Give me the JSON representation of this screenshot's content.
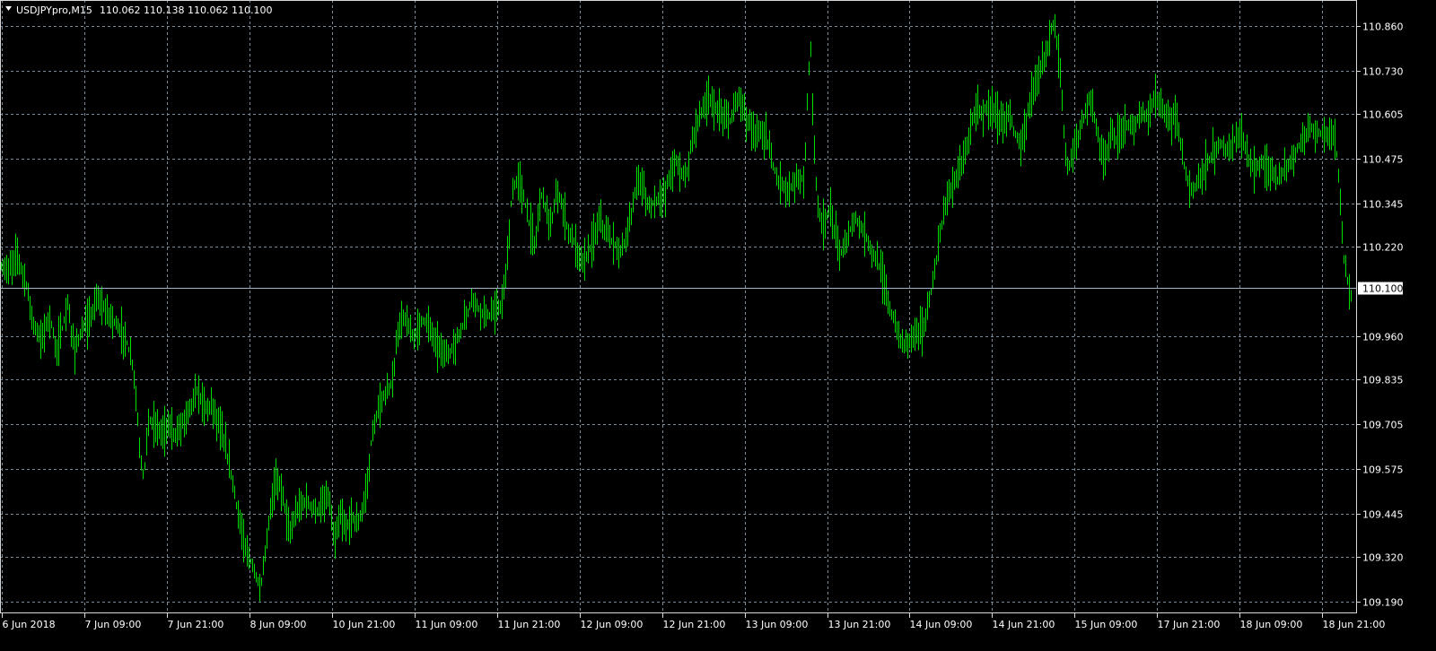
{
  "header": {
    "symbol_label": "USDJPYpro,M15",
    "ohlc": "110.062 110.138 110.062 110.100"
  },
  "colors": {
    "background": "#000000",
    "bars": "#00dd00",
    "grid": "#778899",
    "text": "#ffffff",
    "price_line": "#a0b4c8"
  },
  "icons": {
    "dropdown": "triangle-down-icon"
  },
  "chart_data": {
    "type": "line",
    "style": "ohlc-bars",
    "grid": true,
    "ylim": [
      109.155,
      110.935
    ],
    "y_ticks": [
      "110.860",
      "110.730",
      "110.605",
      "110.475",
      "110.345",
      "110.220",
      "110.100",
      "109.960",
      "109.835",
      "109.705",
      "109.575",
      "109.445",
      "109.320",
      "109.190"
    ],
    "x_ticks": [
      "6 Jun 2018",
      "7 Jun 09:00",
      "7 Jun 21:00",
      "8 Jun 09:00",
      "10 Jun 21:00",
      "11 Jun 09:00",
      "11 Jun 21:00",
      "12 Jun 09:00",
      "12 Jun 21:00",
      "13 Jun 09:00",
      "13 Jun 21:00",
      "14 Jun 09:00",
      "14 Jun 21:00",
      "15 Jun 09:00",
      "17 Jun 21:00",
      "18 Jun 09:00",
      "18 Jun 21:00"
    ],
    "current_price": 110.1,
    "series": [
      {
        "keypoints": [
          [
            0,
            110.16
          ],
          [
            10,
            110.15
          ],
          [
            18,
            110.2
          ],
          [
            30,
            110.1
          ],
          [
            36,
            110.0
          ],
          [
            45,
            109.95
          ],
          [
            55,
            110.02
          ],
          [
            62,
            109.92
          ],
          [
            68,
            109.97
          ],
          [
            75,
            110.05
          ],
          [
            82,
            109.92
          ],
          [
            90,
            109.97
          ],
          [
            100,
            110.01
          ],
          [
            108,
            110.07
          ],
          [
            115,
            110.04
          ],
          [
            122,
            110.02
          ],
          [
            130,
            109.99
          ],
          [
            140,
            109.95
          ],
          [
            148,
            109.87
          ],
          [
            152,
            109.75
          ],
          [
            156,
            109.6
          ],
          [
            160,
            109.55
          ],
          [
            165,
            109.72
          ],
          [
            172,
            109.7
          ],
          [
            180,
            109.68
          ],
          [
            188,
            109.7
          ],
          [
            195,
            109.67
          ],
          [
            205,
            109.72
          ],
          [
            212,
            109.76
          ],
          [
            220,
            109.8
          ],
          [
            228,
            109.75
          ],
          [
            236,
            109.76
          ],
          [
            244,
            109.7
          ],
          [
            252,
            109.62
          ],
          [
            258,
            109.55
          ],
          [
            265,
            109.44
          ],
          [
            272,
            109.35
          ],
          [
            280,
            109.3
          ],
          [
            290,
            109.22
          ],
          [
            296,
            109.35
          ],
          [
            302,
            109.48
          ],
          [
            308,
            109.55
          ],
          [
            315,
            109.5
          ],
          [
            322,
            109.38
          ],
          [
            330,
            109.45
          ],
          [
            338,
            109.48
          ],
          [
            345,
            109.47
          ],
          [
            352,
            109.45
          ],
          [
            360,
            109.47
          ],
          [
            366,
            109.5
          ],
          [
            372,
            109.35
          ],
          [
            378,
            109.44
          ],
          [
            385,
            109.4
          ],
          [
            392,
            109.44
          ],
          [
            398,
            109.41
          ],
          [
            404,
            109.46
          ],
          [
            410,
            109.55
          ],
          [
            414,
            109.68
          ],
          [
            420,
            109.73
          ],
          [
            426,
            109.78
          ],
          [
            432,
            109.8
          ],
          [
            438,
            109.84
          ],
          [
            442,
            109.96
          ],
          [
            448,
            110.02
          ],
          [
            455,
            109.98
          ],
          [
            462,
            109.96
          ],
          [
            470,
            110.01
          ],
          [
            478,
            109.99
          ],
          [
            485,
            109.94
          ],
          [
            492,
            109.92
          ],
          [
            498,
            109.9
          ],
          [
            505,
            109.93
          ],
          [
            512,
            109.97
          ],
          [
            520,
            110.02
          ],
          [
            525,
            110.07
          ],
          [
            530,
            110.05
          ],
          [
            537,
            110.03
          ],
          [
            545,
            110.02
          ],
          [
            552,
            110.03
          ],
          [
            558,
            110.05
          ],
          [
            562,
            110.1
          ],
          [
            566,
            110.22
          ],
          [
            570,
            110.38
          ],
          [
            574,
            110.4
          ],
          [
            578,
            110.42
          ],
          [
            584,
            110.35
          ],
          [
            590,
            110.28
          ],
          [
            596,
            110.22
          ],
          [
            602,
            110.38
          ],
          [
            608,
            110.33
          ],
          [
            614,
            110.28
          ],
          [
            620,
            110.38
          ],
          [
            626,
            110.34
          ],
          [
            632,
            110.27
          ],
          [
            638,
            110.24
          ],
          [
            644,
            110.2
          ],
          [
            650,
            110.17
          ],
          [
            656,
            110.21
          ],
          [
            662,
            110.25
          ],
          [
            668,
            110.3
          ],
          [
            674,
            110.26
          ],
          [
            680,
            110.24
          ],
          [
            686,
            110.22
          ],
          [
            692,
            110.21
          ],
          [
            698,
            110.24
          ],
          [
            704,
            110.33
          ],
          [
            710,
            110.42
          ],
          [
            716,
            110.39
          ],
          [
            722,
            110.33
          ],
          [
            728,
            110.35
          ],
          [
            734,
            110.36
          ],
          [
            740,
            110.37
          ],
          [
            746,
            110.43
          ],
          [
            752,
            110.47
          ],
          [
            758,
            110.44
          ],
          [
            764,
            110.42
          ],
          [
            770,
            110.52
          ],
          [
            776,
            110.58
          ],
          [
            782,
            110.61
          ],
          [
            788,
            110.65
          ],
          [
            794,
            110.63
          ],
          [
            800,
            110.61
          ],
          [
            806,
            110.59
          ],
          [
            812,
            110.58
          ],
          [
            818,
            110.62
          ],
          [
            824,
            110.66
          ],
          [
            830,
            110.6
          ],
          [
            836,
            110.57
          ],
          [
            842,
            110.54
          ],
          [
            848,
            110.56
          ],
          [
            854,
            110.53
          ],
          [
            860,
            110.46
          ],
          [
            866,
            110.42
          ],
          [
            872,
            110.4
          ],
          [
            878,
            110.37
          ],
          [
            884,
            110.41
          ],
          [
            890,
            110.41
          ],
          [
            896,
            110.43
          ],
          [
            900,
            110.7
          ],
          [
            903,
            110.8
          ],
          [
            906,
            110.55
          ],
          [
            910,
            110.35
          ],
          [
            914,
            110.3
          ],
          [
            918,
            110.28
          ],
          [
            924,
            110.33
          ],
          [
            930,
            110.26
          ],
          [
            936,
            110.2
          ],
          [
            942,
            110.22
          ],
          [
            948,
            110.28
          ],
          [
            954,
            110.3
          ],
          [
            960,
            110.27
          ],
          [
            966,
            110.24
          ],
          [
            972,
            110.2
          ],
          [
            978,
            110.17
          ],
          [
            984,
            110.12
          ],
          [
            990,
            110.05
          ],
          [
            996,
            110.0
          ],
          [
            1002,
            109.95
          ],
          [
            1008,
            109.93
          ],
          [
            1014,
            109.96
          ],
          [
            1020,
            109.98
          ],
          [
            1026,
            109.97
          ],
          [
            1032,
            110.02
          ],
          [
            1038,
            110.1
          ],
          [
            1044,
            110.2
          ],
          [
            1048,
            110.27
          ],
          [
            1052,
            110.33
          ],
          [
            1058,
            110.38
          ],
          [
            1064,
            110.42
          ],
          [
            1070,
            110.45
          ],
          [
            1076,
            110.5
          ],
          [
            1082,
            110.58
          ],
          [
            1088,
            110.62
          ],
          [
            1094,
            110.6
          ],
          [
            1100,
            110.63
          ],
          [
            1106,
            110.61
          ],
          [
            1112,
            110.59
          ],
          [
            1118,
            110.58
          ],
          [
            1124,
            110.62
          ],
          [
            1130,
            110.55
          ],
          [
            1136,
            110.52
          ],
          [
            1142,
            110.57
          ],
          [
            1148,
            110.65
          ],
          [
            1154,
            110.72
          ],
          [
            1160,
            110.74
          ],
          [
            1166,
            110.77
          ],
          [
            1170,
            110.85
          ],
          [
            1174,
            110.86
          ],
          [
            1178,
            110.8
          ],
          [
            1182,
            110.7
          ],
          [
            1186,
            110.5
          ],
          [
            1190,
            110.44
          ],
          [
            1196,
            110.5
          ],
          [
            1202,
            110.55
          ],
          [
            1208,
            110.6
          ],
          [
            1214,
            110.66
          ],
          [
            1220,
            110.58
          ],
          [
            1226,
            110.5
          ],
          [
            1232,
            110.47
          ],
          [
            1238,
            110.55
          ],
          [
            1244,
            110.52
          ],
          [
            1250,
            110.56
          ],
          [
            1256,
            110.58
          ],
          [
            1262,
            110.56
          ],
          [
            1268,
            110.59
          ],
          [
            1274,
            110.6
          ],
          [
            1280,
            110.59
          ],
          [
            1286,
            110.66
          ],
          [
            1292,
            110.63
          ],
          [
            1298,
            110.61
          ],
          [
            1304,
            110.58
          ],
          [
            1310,
            110.61
          ],
          [
            1316,
            110.5
          ],
          [
            1320,
            110.44
          ],
          [
            1326,
            110.38
          ],
          [
            1332,
            110.4
          ],
          [
            1338,
            110.43
          ],
          [
            1344,
            110.46
          ],
          [
            1350,
            110.48
          ],
          [
            1356,
            110.51
          ],
          [
            1362,
            110.52
          ],
          [
            1368,
            110.49
          ],
          [
            1374,
            110.53
          ],
          [
            1380,
            110.55
          ],
          [
            1386,
            110.52
          ],
          [
            1392,
            110.46
          ],
          [
            1398,
            110.44
          ],
          [
            1404,
            110.46
          ],
          [
            1410,
            110.47
          ],
          [
            1416,
            110.44
          ],
          [
            1422,
            110.41
          ],
          [
            1428,
            110.43
          ],
          [
            1434,
            110.45
          ],
          [
            1440,
            110.48
          ],
          [
            1446,
            110.51
          ],
          [
            1452,
            110.53
          ],
          [
            1458,
            110.57
          ],
          [
            1464,
            110.56
          ],
          [
            1470,
            110.55
          ],
          [
            1476,
            110.55
          ],
          [
            1482,
            110.54
          ],
          [
            1488,
            110.52
          ],
          [
            1492,
            110.4
          ],
          [
            1496,
            110.2
          ],
          [
            1500,
            110.14
          ],
          [
            1504,
            110.05
          ],
          [
            1506,
            110.1
          ]
        ]
      }
    ]
  }
}
